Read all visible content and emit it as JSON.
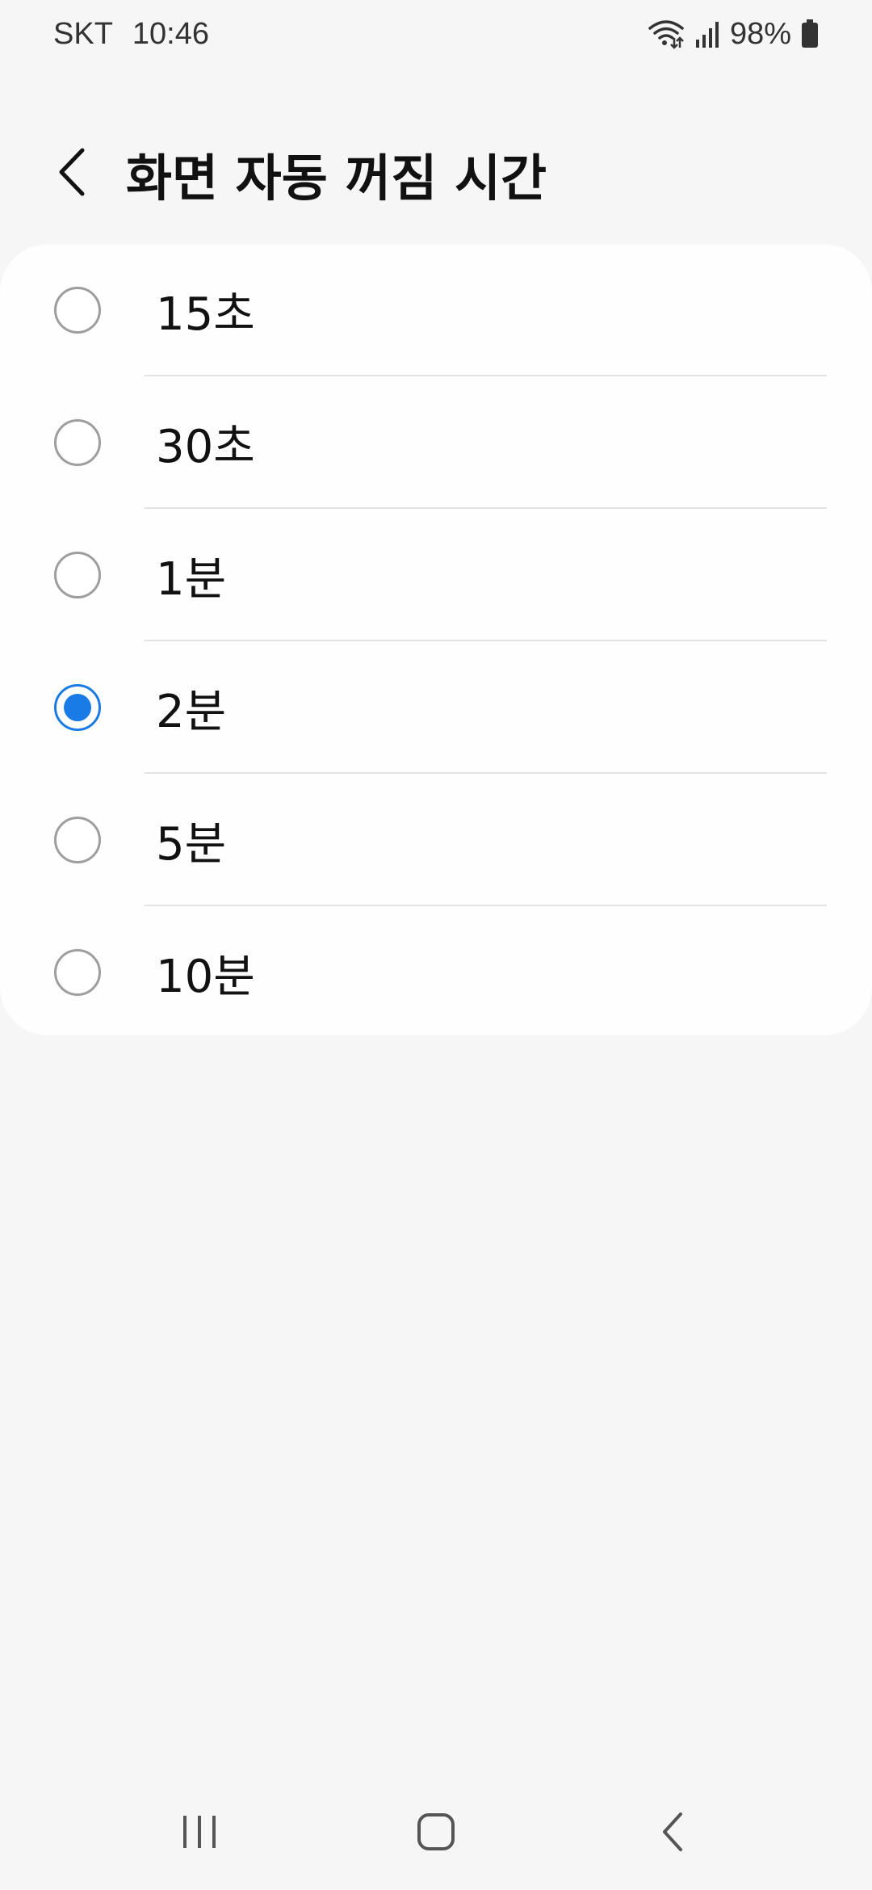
{
  "status_bar": {
    "carrier": "SKT",
    "time": "10:46",
    "battery": "98%",
    "icons": [
      "wifi-icon",
      "signal-icon",
      "battery-icon"
    ]
  },
  "header": {
    "title": "화면 자동 꺼짐 시간",
    "back_icon": "chevron-left-icon"
  },
  "options": [
    {
      "label": "15초",
      "selected": false
    },
    {
      "label": "30초",
      "selected": false
    },
    {
      "label": "1분",
      "selected": false
    },
    {
      "label": "2분",
      "selected": true
    },
    {
      "label": "5분",
      "selected": false
    },
    {
      "label": "10분",
      "selected": false
    }
  ],
  "nav_bar": {
    "icons": [
      "recent-apps-icon",
      "home-icon",
      "back-icon"
    ]
  },
  "colors": {
    "accent": "#1a7ae6",
    "background": "#f6f6f6",
    "card": "#fefefe"
  }
}
